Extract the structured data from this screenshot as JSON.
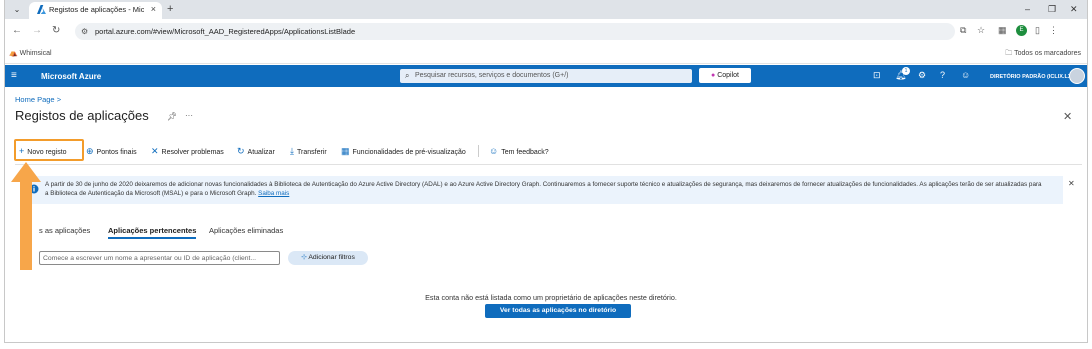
{
  "browser": {
    "tab_title": "Registos de aplicações - Micro",
    "url": "portal.azure.com/#view/Microsoft_AAD_RegisteredApps/ApplicationsListBlade",
    "bookmark": "Whimsical",
    "bookmarks_all": "Todos os marcadores",
    "profile_initial": "E"
  },
  "azure": {
    "brand": "Microsoft Azure",
    "search_placeholder": "Pesquisar recursos, serviços e documentos (G+/)",
    "copilot": "Copilot",
    "directory": "DIRETÓRIO PADRÃO (ICLIX.LX)",
    "notification_count": "1"
  },
  "page": {
    "breadcrumb": "Home Page >",
    "title": "Registos de aplicações"
  },
  "toolbar": {
    "new": "Novo registo",
    "endpoints": "Pontos finais",
    "troubleshoot": "Resolver problemas",
    "refresh": "Atualizar",
    "download": "Transferir",
    "preview": "Funcionalidades de pré-visualização",
    "feedback": "Tem feedback?"
  },
  "banner": {
    "text": "A partir de 30 de junho de 2020 deixaremos de adicionar novas funcionalidades à Biblioteca de Autenticação do Azure Active Directory (ADAL) e ao Azure Active Directory Graph. Continuaremos a fornecer suporte técnico e atualizações de segurança, mas deixaremos de fornecer atualizações de funcionalidades. As aplicações terão de ser atualizadas para a Biblioteca de Autenticação da Microsoft (MSAL) e para o Microsoft Graph.",
    "link": "Saiba mais"
  },
  "tabs": {
    "all": "s as aplicações",
    "owned": "Aplicações pertencentes",
    "deleted": "Aplicações eliminadas"
  },
  "filter": {
    "placeholder": "Comece a escrever um nome a apresentar ou ID de aplicação (client...",
    "add_filter": "Adicionar filtros"
  },
  "empty": {
    "message": "Esta conta não está listada como um proprietário de aplicações neste diretório.",
    "button": "Ver todas as aplicações no diretório"
  },
  "colors": {
    "azure_blue": "#0f6cbd",
    "highlight_orange": "#f39c2b"
  }
}
